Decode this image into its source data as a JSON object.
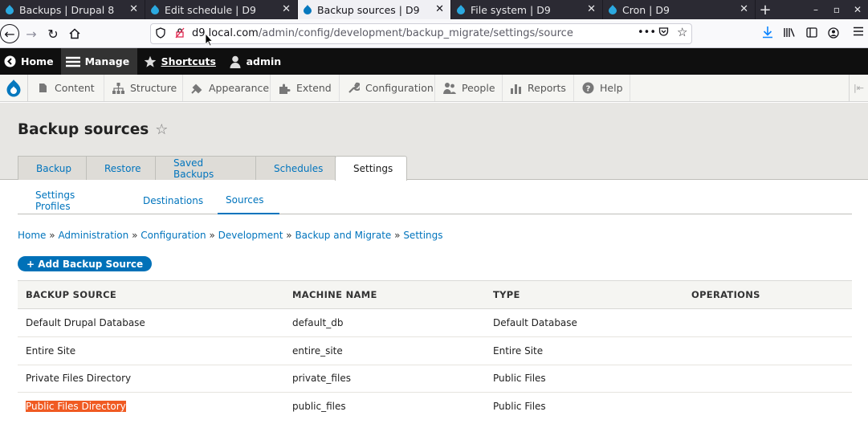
{
  "browser": {
    "tabs": [
      {
        "title": "Backups | Drupal 8",
        "active": false
      },
      {
        "title": "Edit schedule | D9",
        "active": false
      },
      {
        "title": "Backup sources | D9",
        "active": true
      },
      {
        "title": "File system | D9",
        "active": false
      },
      {
        "title": "Cron | D9",
        "active": false
      }
    ],
    "new_tab": "+",
    "url_host": "d9.local.com",
    "url_path": "/admin/config/development/backup_migrate/settings/source"
  },
  "toolbar": {
    "home": "Home",
    "manage": "Manage",
    "shortcuts": "Shortcuts",
    "user": "admin"
  },
  "admin_menu": [
    {
      "label": "Content",
      "icon": "content-icon"
    },
    {
      "label": "Structure",
      "icon": "structure-icon"
    },
    {
      "label": "Appearance",
      "icon": "appearance-icon"
    },
    {
      "label": "Extend",
      "icon": "extend-icon"
    },
    {
      "label": "Configuration",
      "icon": "wrench-icon"
    },
    {
      "label": "People",
      "icon": "people-icon"
    },
    {
      "label": "Reports",
      "icon": "reports-icon"
    },
    {
      "label": "Help",
      "icon": "help-icon"
    }
  ],
  "page": {
    "title": "Backup sources",
    "primary_tabs": [
      "Backup",
      "Restore",
      "Saved Backups",
      "Schedules",
      "Settings"
    ],
    "active_primary_tab": "Settings",
    "secondary_tabs": [
      "Settings Profiles",
      "Destinations",
      "Sources"
    ],
    "active_secondary_tab": "Sources",
    "breadcrumb": [
      "Home",
      "Administration",
      "Configuration",
      "Development",
      "Backup and Migrate",
      "Settings"
    ],
    "breadcrumb_separator": "»",
    "add_button": "+ Add Backup Source"
  },
  "table": {
    "headers": [
      "BACKUP SOURCE",
      "MACHINE NAME",
      "TYPE",
      "OPERATIONS"
    ],
    "rows": [
      [
        "Default Drupal Database",
        "default_db",
        "Default Database",
        ""
      ],
      [
        "Entire Site",
        "entire_site",
        "Entire Site",
        ""
      ],
      [
        "Private Files Directory",
        "private_files",
        "Public Files",
        ""
      ],
      [
        "Public Files Directory",
        "public_files",
        "Public Files",
        ""
      ]
    ],
    "highlighted_cell": "Public Files Directory"
  },
  "colors": {
    "link": "#0074bd",
    "button": "#0071b8",
    "highlight": "#f05a22",
    "toolbar": "#0f0f0f"
  }
}
